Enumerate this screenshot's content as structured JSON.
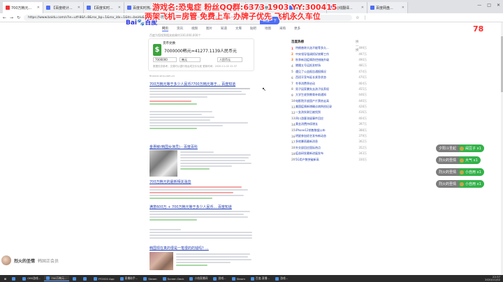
{
  "browser": {
    "tabs": [
      {
        "label": "700万韩元..."
      },
      {
        "label": "【百度统计..."
      },
      {
        "label": "【百度实时..."
      },
      {
        "label": "百度实时热..."
      },
      {
        "label": "韩国综合..."
      },
      {
        "label": "百度热搜..."
      },
      {
        "label": "百度热榜..."
      },
      {
        "label": "百度游戏..."
      },
      {
        "label": "在线翻译..."
      },
      {
        "label": "百度网盘..."
      }
    ],
    "url": "https://www.baidu.com/s?ie=utf-8&f=8&rsv_bp=1&rsv_idx=1&tn=baidu&wd=700万韩元等于多少人民币",
    "controls": [
      "—",
      "□",
      "✕"
    ]
  },
  "overlay": {
    "line1": "游戏名:恐鬼症   粉丝QQ群:6373  1903   YY:300415",
    "line2": "两架飞机=房管   免费上车   办牌子优先   飞机永久车位",
    "count": "78"
  },
  "baidu": {
    "logo_bai": "Bai",
    "logo_du": "度",
    "logo_end": "百度",
    "search_button": "百度一下",
    "tabs": [
      "网页",
      "资讯",
      "视频",
      "图片",
      "知道",
      "文库",
      "贴吧",
      "地图",
      "采购",
      "更多"
    ],
    "found": "百度为您找到相关结果约100,000,000个"
  },
  "calculator": {
    "title": "货币兑换",
    "symbol": "$",
    "result": "7000000韩元=41277.1139人民币元",
    "input_amount": "7000000",
    "from_currency": "韩元",
    "to_currency": "人民币元",
    "note": "数据仅供参考，交易时以银行柜台成交价为准 更新时间：2020-11-02 22:37"
  },
  "source": "finance.sina.com.cn",
  "results": [
    {
      "title": "700万韩元等于多少人民币?700万韩元等于... 百度知道"
    },
    {
      "title": "700万韩元等于多少人民币 - 百度知道"
    },
    {
      "title": "金惠敏(韩国女演员) - 百度百科"
    },
    {
      "title": "700万韩元的最新相关消息"
    },
    {
      "title": "满意600万 + 700万韩元等于多少人民币... 百度知道"
    },
    {
      "title": "韩国现在真的很是一笔很的的钱吗？..."
    }
  ],
  "hot": {
    "header": "百度热榜",
    "refresh": "换一换",
    "items": [
      {
        "num": "1",
        "text": "特朗普称大选不能等多久...",
        "val": "499万"
      },
      {
        "num": "2",
        "text": "中央领导强调抓好统筹工作",
        "val": "497万"
      },
      {
        "num": "3",
        "text": "秋季新冠疫情防控措施升级",
        "val": "490万"
      },
      {
        "num": "4",
        "text": "嫦娥五号运抵发射场",
        "val": "481万"
      },
      {
        "num": "5",
        "text": "遇见了公益报告通报情况",
        "val": "474万"
      },
      {
        "num": "6",
        "text": "西班牙宣布延长紧急状态",
        "val": "470万"
      },
      {
        "num": "7",
        "text": "冬季消费季启动",
        "val": "464万"
      },
      {
        "num": "8",
        "text": "男子因家暴失去孩子抚养权",
        "val": "455万"
      },
      {
        "num": "9",
        "text": "大学生收到教育补助通知",
        "val": "446万"
      },
      {
        "num": "10",
        "text": "电影院开放国产片票房走高",
        "val": "440万"
      },
      {
        "num": "11",
        "text": "美国疫情新增确诊病例创纪录",
        "val": "428万"
      },
      {
        "num": "12",
        "text": "一女孩失联后被找到",
        "val": "416万"
      },
      {
        "num": "13",
        "text": "四川游客滞留事件回应",
        "val": "404万"
      },
      {
        "num": "14",
        "text": "黄金消费持续增长",
        "val": "397万"
      },
      {
        "num": "15",
        "text": "iPhone12销售数据公布",
        "val": "388万"
      },
      {
        "num": "16",
        "text": "明星参加综艺发布新动态",
        "val": "379万"
      },
      {
        "num": "17",
        "text": "多地暴雨最新消息",
        "val": "362万"
      },
      {
        "num": "18",
        "text": "外交部回应国际热点",
        "val": "352万"
      },
      {
        "num": "19",
        "text": "疫苗研发最新进展发布",
        "val": "343万"
      },
      {
        "num": "20",
        "text": "5G用户数突破新高",
        "val": "330万"
      }
    ]
  },
  "chat": [
    {
      "user": "夕阳斗圣起",
      "gift": "闹豆子 x1"
    },
    {
      "user": "烈火的圣情",
      "gift": "大气 x1"
    },
    {
      "user": "烈火的圣情",
      "gift": "小自用 x1"
    },
    {
      "user": "烈火的圣情",
      "gift": "小自用 x1"
    }
  ],
  "streamer": {
    "name": "烈火的圣情",
    "tag": "韩国正会员"
  },
  "taskbar": {
    "items": [
      "",
      "OBS游戏...",
      "700万韩元...",
      "",
      "",
      "YY2020 App",
      "直播助手...",
      "Steam",
      "Screen Deck",
      "小拍直播间",
      "游戏...",
      "Steam",
      "百度-直播...",
      "游戏..."
    ],
    "time": "22:37",
    "date": "2020/11/02"
  }
}
